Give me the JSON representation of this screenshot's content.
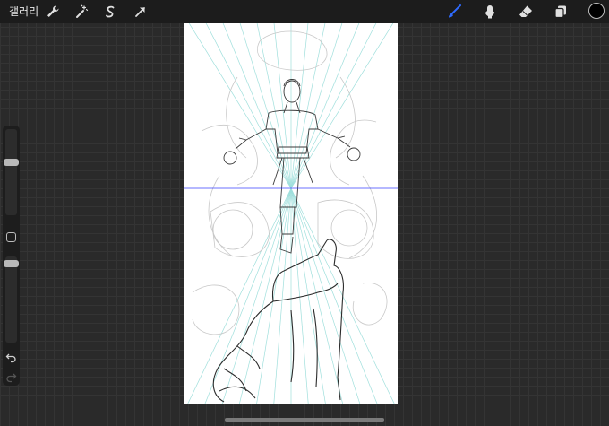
{
  "topbar": {
    "gallery_label": "갤러리",
    "left_tools": [
      "wrench-icon",
      "magic-wand-icon",
      "selection-icon",
      "transform-arrow-icon"
    ],
    "right_tools": [
      "brush-icon",
      "smudge-icon",
      "eraser-icon",
      "layers-icon"
    ],
    "active_tool": "brush",
    "accent_color": "#2f6bff",
    "current_color": "#000000"
  },
  "sidebar": {
    "brush_size_level": 0.62,
    "opacity_level": 0.05,
    "buttons": [
      "modify-square",
      "undo",
      "redo"
    ]
  },
  "canvas": {
    "guide_color": "#9fdfdc",
    "horizon_color": "#3a40ff",
    "sketch_color": "#2e2e2e"
  }
}
